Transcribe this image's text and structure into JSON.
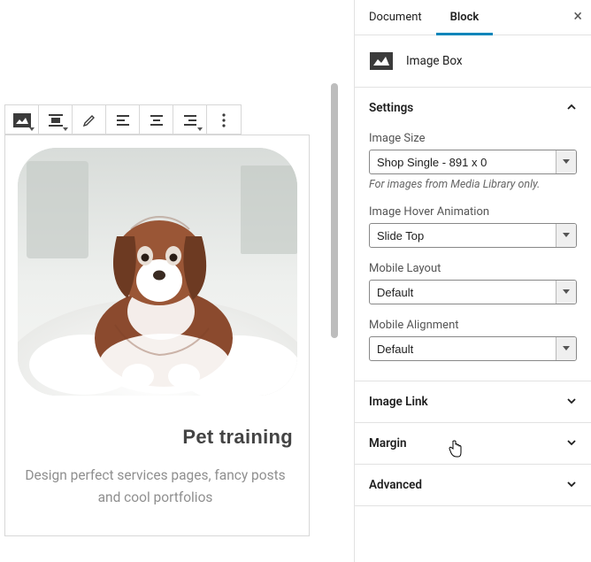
{
  "tabs": {
    "document": "Document",
    "block": "Block"
  },
  "block_card": {
    "title": "Image Box"
  },
  "panels": {
    "settings": {
      "title": "Settings",
      "fields": {
        "image_size": {
          "label": "Image Size",
          "value": "Shop Single - 891 x 0",
          "help": "For images from Media Library only."
        },
        "hover_anim": {
          "label": "Image Hover Animation",
          "value": "Slide Top"
        },
        "mobile_layout": {
          "label": "Mobile Layout",
          "value": "Default"
        },
        "mobile_align": {
          "label": "Mobile Alignment",
          "value": "Default"
        }
      }
    },
    "image_link": {
      "title": "Image Link"
    },
    "margin": {
      "title": "Margin"
    },
    "advanced": {
      "title": "Advanced"
    }
  },
  "content": {
    "heading": "Pet training",
    "description": "Design perfect services pages, fancy posts and cool portfolios"
  }
}
